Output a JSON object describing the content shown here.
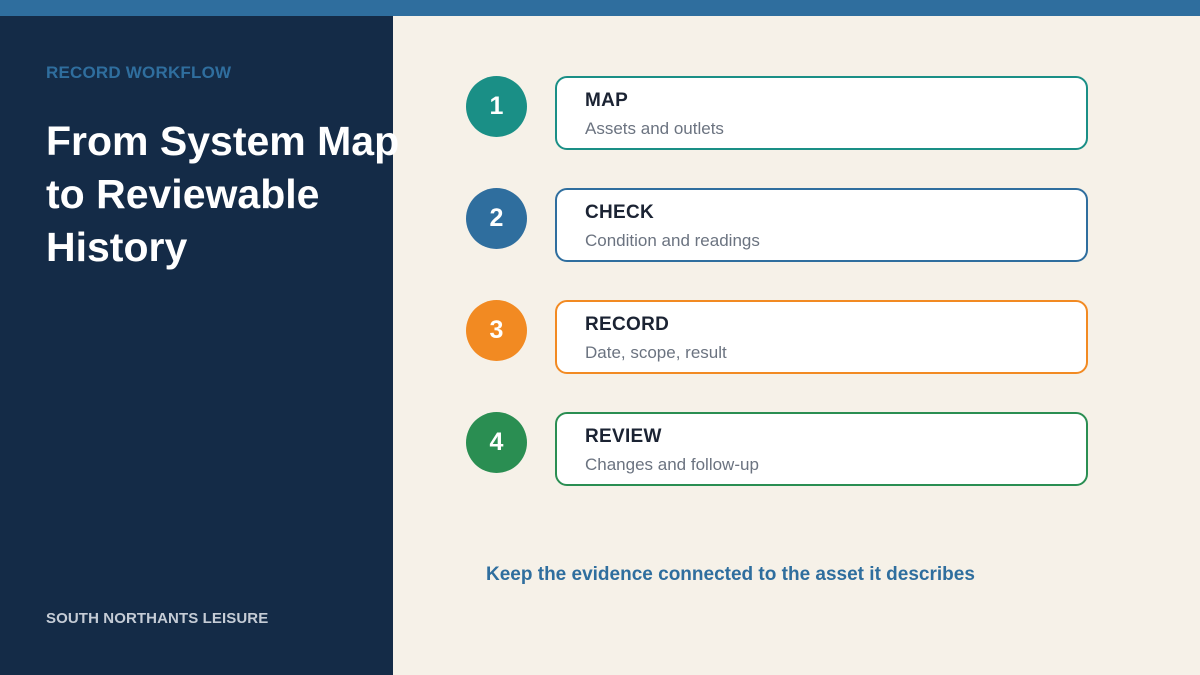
{
  "eyebrow": "RECORD WORKFLOW",
  "title": "From System Map\nto Reviewable\nHistory",
  "organisation": "SOUTH NORTHANTS LEISURE",
  "steps": [
    {
      "number": "1",
      "title": "MAP",
      "description": "Assets and outlets",
      "color": "#1a8f86"
    },
    {
      "number": "2",
      "title": "CHECK",
      "description": "Condition and readings",
      "color": "#2f6e9e"
    },
    {
      "number": "3",
      "title": "RECORD",
      "description": "Date, scope, result",
      "color": "#f28a22"
    },
    {
      "number": "4",
      "title": "REVIEW",
      "description": "Changes and follow-up",
      "color": "#2a8e52"
    }
  ],
  "tagline": "Keep the evidence connected to the asset it describes",
  "colors": {
    "top_bar": "#2f6e9e",
    "left_panel": "#142b47",
    "right_panel": "#f6f1e8"
  }
}
